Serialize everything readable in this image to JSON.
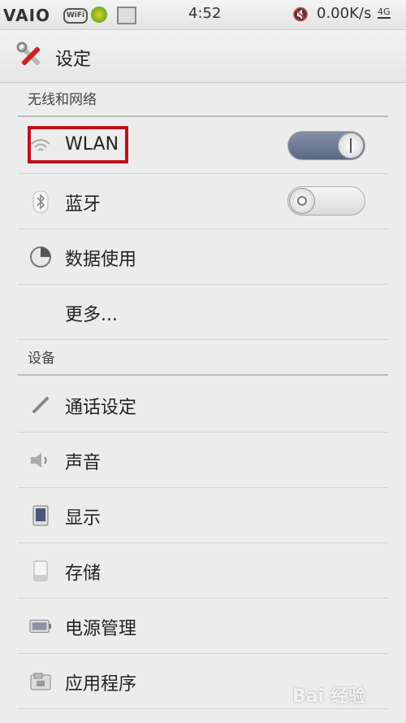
{
  "status_bar": {
    "brand": "VAIO",
    "wifi_badge": "WiFi",
    "time": "4:52",
    "net_speed": "0.00K/s",
    "signal": "4G"
  },
  "header": {
    "title": "设定"
  },
  "sections": [
    {
      "label": "无线和网络"
    },
    {
      "label": "设备"
    }
  ],
  "rows": {
    "wlan": {
      "label": "WLAN",
      "toggle": "on"
    },
    "bluetooth": {
      "label": "蓝牙",
      "toggle": "off"
    },
    "data_usage": {
      "label": "数据使用"
    },
    "more": {
      "label": "更多..."
    },
    "call_settings": {
      "label": "通话设定"
    },
    "sound": {
      "label": "声音"
    },
    "display": {
      "label": "显示"
    },
    "storage": {
      "label": "存储"
    },
    "power": {
      "label": "电源管理"
    },
    "apps": {
      "label": "应用程序"
    }
  },
  "watermark": "Bai 经验"
}
